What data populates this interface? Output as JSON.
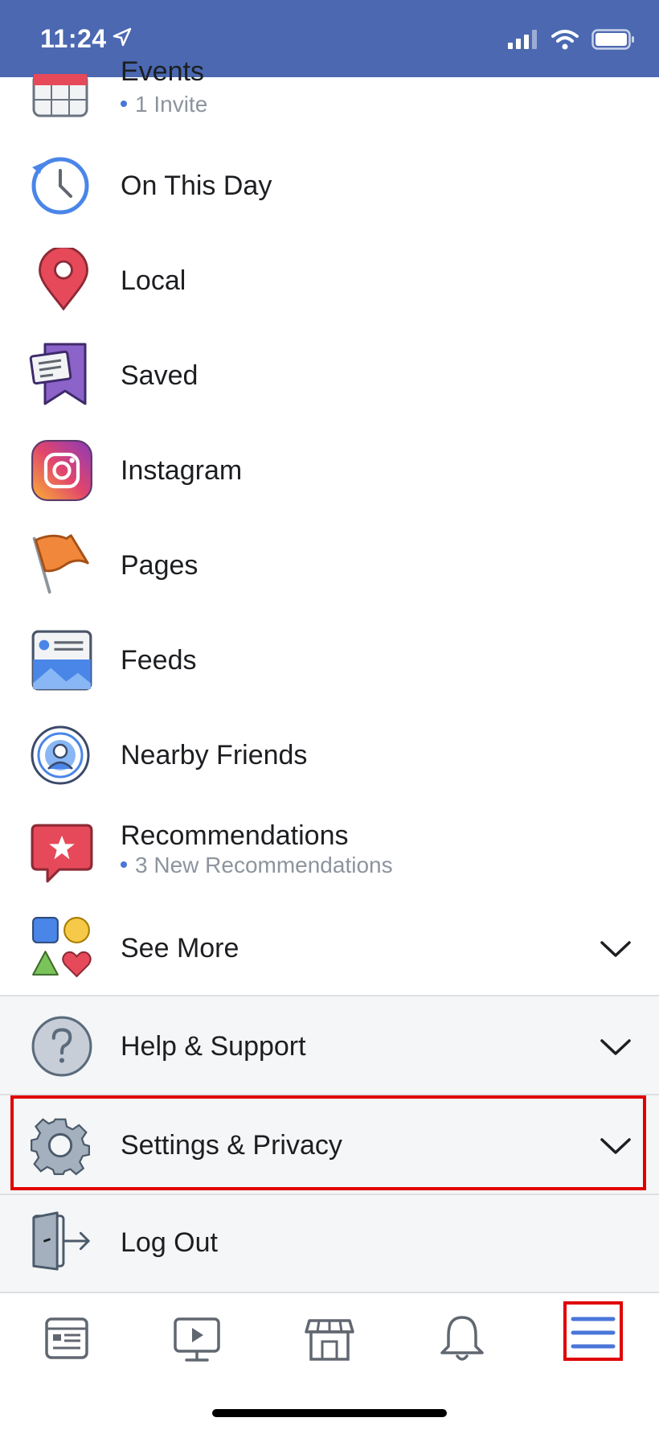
{
  "status_bar": {
    "time": "11:24"
  },
  "menu": {
    "events": {
      "label": "Events",
      "sub": "1 Invite"
    },
    "on_this_day": {
      "label": "On This Day"
    },
    "local": {
      "label": "Local"
    },
    "saved": {
      "label": "Saved"
    },
    "instagram": {
      "label": "Instagram"
    },
    "pages": {
      "label": "Pages"
    },
    "feeds": {
      "label": "Feeds"
    },
    "nearby_friends": {
      "label": "Nearby Friends"
    },
    "recommendations": {
      "label": "Recommendations",
      "sub": "3 New Recommendations"
    },
    "see_more": {
      "label": "See More"
    },
    "help_support": {
      "label": "Help & Support"
    },
    "settings_privacy": {
      "label": "Settings & Privacy"
    },
    "log_out": {
      "label": "Log Out"
    }
  },
  "tabbar": {
    "tabs": [
      "news-feed-icon",
      "watch-icon",
      "marketplace-icon",
      "notifications-icon",
      "menu-icon"
    ]
  },
  "colors": {
    "brand": "#4b68b1",
    "highlight": "#e00000",
    "accent": "#4a76d8"
  }
}
